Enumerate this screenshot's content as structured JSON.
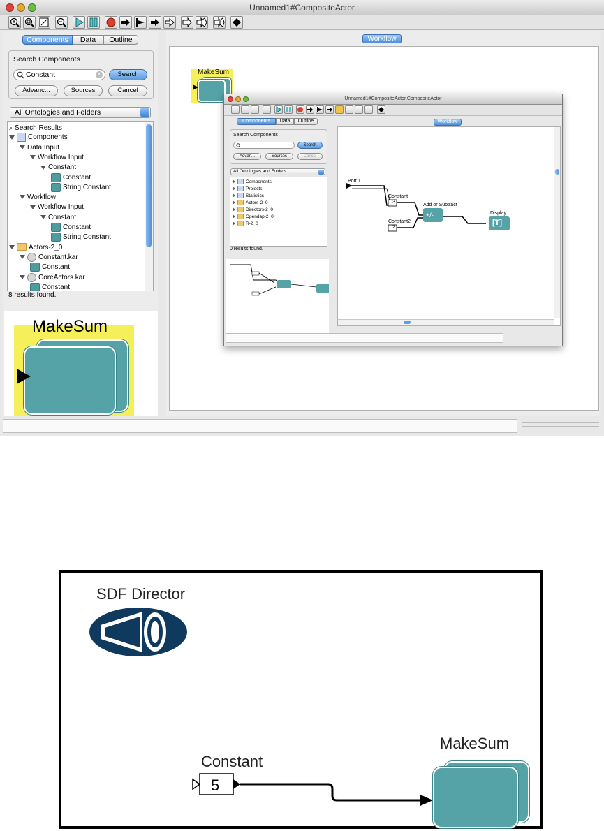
{
  "window": {
    "title": "Unnamed1#CompositeActor",
    "toolbar_icons": [
      "zoom-in-icon",
      "zoom-reset-icon",
      "zoom-fit-icon",
      "zoom-out-icon",
      "run-icon",
      "pause-icon",
      "stop-icon",
      "right-arrow-icon",
      "step-icon",
      "arrow-icon",
      "double-arrow-icon",
      "port-icon",
      "multiport-icon",
      "relation-icon"
    ]
  },
  "left_panel": {
    "tabs": [
      "Components",
      "Data",
      "Outline"
    ],
    "search_group_label": "Search Components",
    "search_value": "Constant",
    "search_button": "Search",
    "advanced_button": "Advanc...",
    "sources_button": "Sources",
    "cancel_button": "Cancel",
    "ontology_select": "All Ontologies and Folders",
    "tree": [
      {
        "label": "Search Results",
        "level": 0,
        "icon": "magnifier-icon"
      },
      {
        "label": "Components",
        "level": 0,
        "icon": "book-icon"
      },
      {
        "label": "Data Input",
        "level": 1,
        "icon": ""
      },
      {
        "label": "Workflow Input",
        "level": 2,
        "icon": ""
      },
      {
        "label": "Constant",
        "level": 3,
        "icon": ""
      },
      {
        "label": "Constant",
        "level": 4,
        "icon": "actor-icon"
      },
      {
        "label": "String Constant",
        "level": 4,
        "icon": "actor-icon"
      },
      {
        "label": "Workflow",
        "level": 1,
        "icon": ""
      },
      {
        "label": "Workflow Input",
        "level": 2,
        "icon": ""
      },
      {
        "label": "Constant",
        "level": 3,
        "icon": ""
      },
      {
        "label": "Constant",
        "level": 4,
        "icon": "actor-icon"
      },
      {
        "label": "String Constant",
        "level": 4,
        "icon": "actor-icon"
      },
      {
        "label": "Actors-2_0",
        "level": 0,
        "icon": "folder-icon"
      },
      {
        "label": "Constant.kar",
        "level": 1,
        "icon": "kar-icon"
      },
      {
        "label": "Constant",
        "level": 2,
        "icon": "actor-icon"
      },
      {
        "label": "CoreActors.kar",
        "level": 1,
        "icon": "kar-icon"
      },
      {
        "label": "Constant",
        "level": 2,
        "icon": "actor-icon"
      }
    ],
    "results_text": "8 results found.",
    "preview_actor_label": "MakeSum"
  },
  "canvas": {
    "tab": "Workflow",
    "actor_label": "MakeSum"
  },
  "nested_window": {
    "title": "Unnamed1#CompositeActor.CompositeActor",
    "tabs": [
      "Components",
      "Data",
      "Outline"
    ],
    "search_group_label": "Search Components",
    "search_button": "Search",
    "advanced_button": "Advan...",
    "sources_button": "Sources",
    "cancel_button": "Cancel",
    "ontology_select": "All Ontologies and Folders",
    "tree": [
      "Components",
      "Projects",
      "Statistics",
      "Actors-2_0",
      "Directors-2_0",
      "Opendap-2_0",
      "R-2_0"
    ],
    "results_text": "0 results found.",
    "workflow_tab": "Workflow",
    "port_label": "Port 1",
    "constant1_label": "Constant",
    "constant1_value": "3",
    "constant2_label": "Constant2",
    "constant2_value": "2",
    "adder_label": "Add or Subtract",
    "adder_symbol": "+/-",
    "display_label": "Display",
    "display_symbol": "[T]"
  },
  "zoomed_diagram": {
    "director_label": "SDF Director",
    "constant_label": "Constant",
    "constant_value": "5",
    "actor_label": "MakeSum"
  }
}
